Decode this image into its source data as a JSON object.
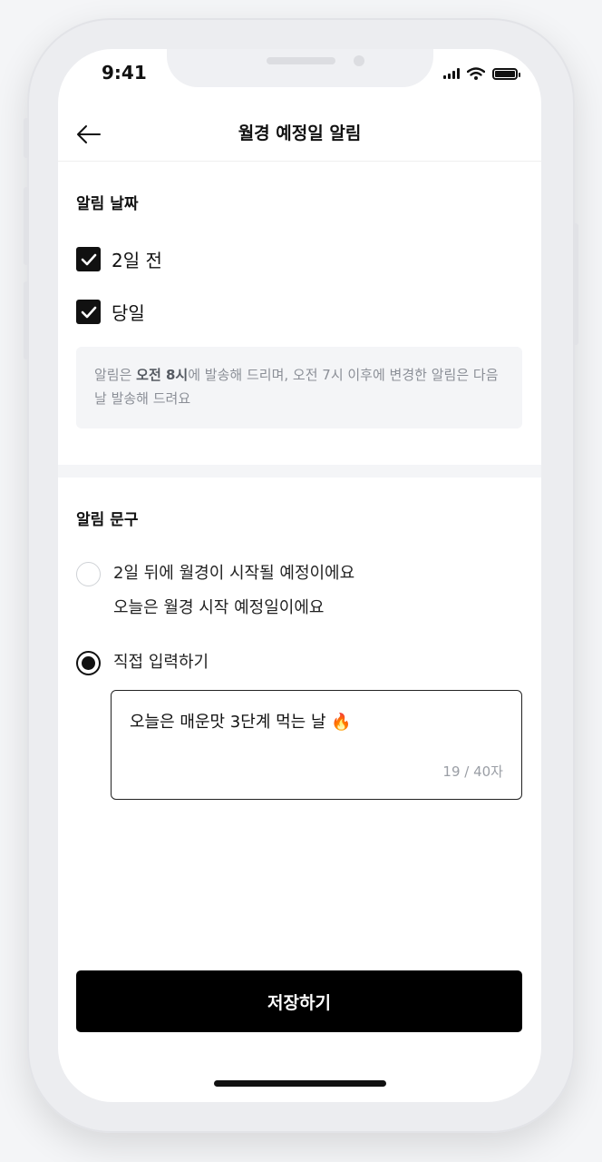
{
  "status_bar": {
    "time": "9:41"
  },
  "header": {
    "title": "월경 예정일 알림",
    "back_icon": "arrow-left-icon"
  },
  "date_section": {
    "title": "알림 날짜",
    "options": [
      {
        "label": "2일 전",
        "checked": true
      },
      {
        "label": "당일",
        "checked": true
      }
    ],
    "info": {
      "prefix": "알림은 ",
      "bold": "오전 8시",
      "suffix": "에 발송해 드리며, 오전 7시 이후에 변경한 알림은 다음날 발송해 드려요"
    }
  },
  "message_section": {
    "title": "알림 문구",
    "preset_option": {
      "line1": "2일 뒤에 월경이 시작될 예정이에요",
      "line2": "오늘은 월경 시작 예정일이에요",
      "selected": false
    },
    "custom_option": {
      "label": "직접 입력하기",
      "selected": true
    },
    "custom_input": {
      "value": "오늘은 매운맛 3단계 먹는 날 🔥",
      "counter": "19 / 40자"
    }
  },
  "save_button": {
    "label": "저장하기"
  },
  "colors": {
    "primary": "#000000",
    "muted_text": "#8b8f97",
    "info_bg": "#f4f5f7"
  }
}
